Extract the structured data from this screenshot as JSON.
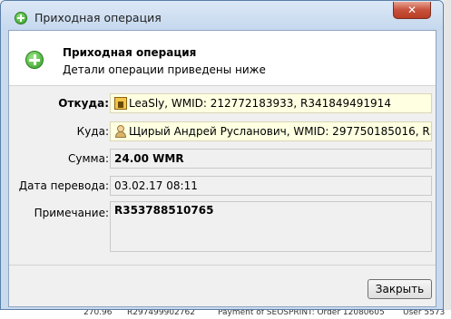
{
  "window": {
    "title": "Приходная операция",
    "close_label": "✕"
  },
  "header": {
    "title": "Приходная операция",
    "subtitle": "Детали операции приведены ниже"
  },
  "fields": {
    "from_label": "Откуда:",
    "from_value": "LeaSly, WMID: 212772183933, R341849491914",
    "to_label": "Куда:",
    "to_value": "Щирый Андрей Русланович, WMID: 297750185016, R35378851...",
    "amount_label": "Сумма:",
    "amount_value": "24.00 WMR",
    "date_label": "Дата перевода:",
    "date_value": "03.02.17 08:11",
    "note_label": "Примечание:",
    "note_value": "R353788510765"
  },
  "buttons": {
    "close": "Закрыть"
  },
  "background_strip": {
    "text1": "270.96",
    "text2": "R297499902762",
    "text3": "Payment of SEOSPRINT: Order 12080605",
    "text4": "User 5573"
  },
  "icons": {
    "title_icon": "plus-circle-icon",
    "header_icon": "plus-circle-icon",
    "from_icon": "shop-icon",
    "to_icon": "user-icon"
  },
  "colors": {
    "accent_green": "#2e9a23",
    "highlight_field": "#ffffe1",
    "close_button": "#c7513b"
  }
}
